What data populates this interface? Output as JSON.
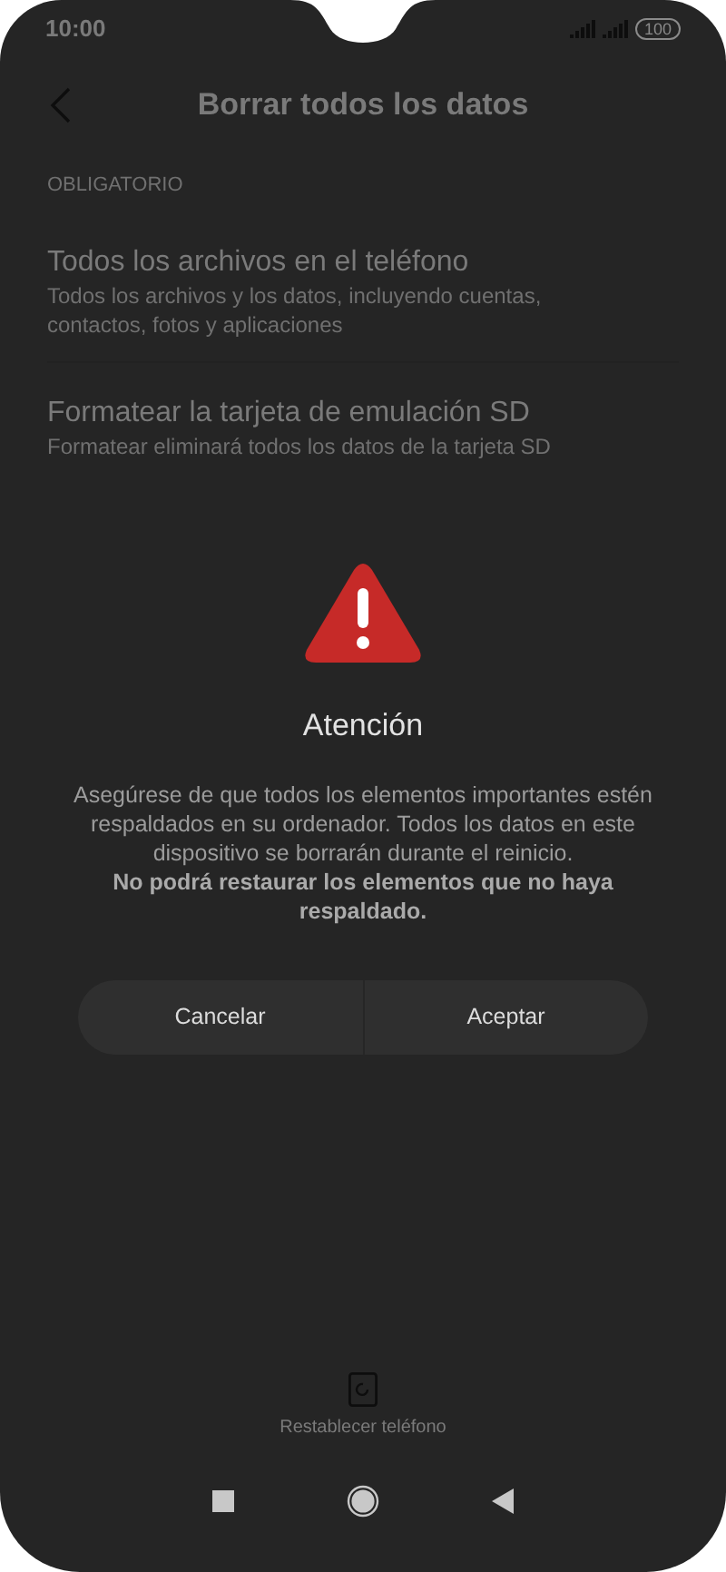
{
  "status_bar": {
    "time": "10:00",
    "battery": "100"
  },
  "header": {
    "title": "Borrar todos los datos"
  },
  "section": {
    "label": "OBLIGATORIO"
  },
  "options": [
    {
      "title": "Todos los archivos en el teléfono",
      "subtitle": "Todos los archivos y los datos, incluyendo cuentas, contactos, fotos y aplicaciones"
    },
    {
      "title": "Formatear la tarjeta de emulación SD",
      "subtitle": "Formatear eliminará todos los datos de la tarjeta SD"
    }
  ],
  "dialog": {
    "title": "Atención",
    "message": "Asegúrese de que todos los elementos importantes estén respaldados en su ordenador. Todos los datos en este dispositivo se borrarán durante el reinicio.",
    "warning": "No podrá restaurar los elementos que no haya respaldado.",
    "buttons": [
      "Cancelar",
      "Aceptar"
    ]
  },
  "footer": {
    "label": "Restablecer teléfono"
  }
}
